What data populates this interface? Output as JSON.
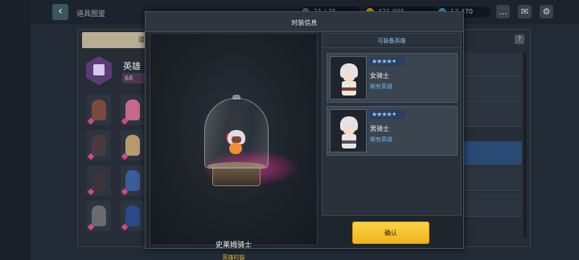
{
  "header": {
    "back_icon": "chevron-left-icon",
    "title": "道具图鉴",
    "stamina": "21 / 35",
    "gold": "421,995",
    "gems": "17,470",
    "icons": [
      "chat-icon",
      "mail-icon",
      "gear-icon"
    ]
  },
  "left_panel": {
    "tab_label": "道",
    "category_label": "英雄",
    "count": "68"
  },
  "right_panel": {
    "help_label": "?"
  },
  "modal": {
    "title": "时装信息",
    "item": {
      "name": "史莱姆骑士",
      "type": "英雄时装"
    },
    "heroes_header": "可装备英雄",
    "heroes": [
      {
        "stars": "★★★★✦",
        "name": "女骑士",
        "rank": "稀有英雄"
      },
      {
        "stars": "★★★★✦",
        "name": "男骑士",
        "rank": "稀有英雄"
      }
    ],
    "confirm_label": "确认"
  },
  "colors": {
    "confirm_button": "#f5c132",
    "item_type_text": "#e2b23a",
    "rank_text": "#6cb2ec",
    "pedestal_glow": "#d6328c"
  }
}
